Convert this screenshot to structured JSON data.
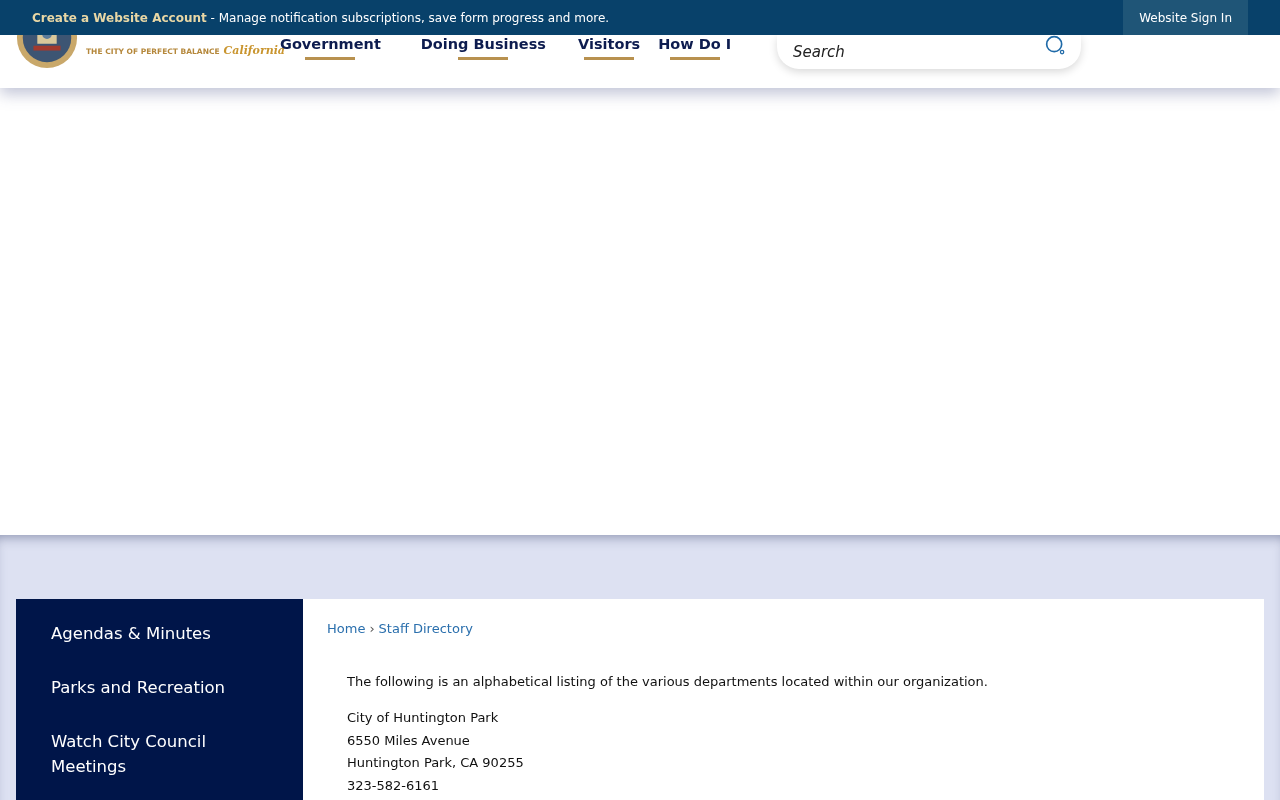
{
  "top_bar": {
    "account_link": "Create a Website Account",
    "message": " - Manage notification subscriptions, save form progress and more.",
    "sign_in": "Website Sign In"
  },
  "logo": {
    "tagline": "THE CITY OF PERFECT BALANCE",
    "state": "California"
  },
  "nav": [
    {
      "label": "Government"
    },
    {
      "label": "Doing Business"
    },
    {
      "label": "Visitors"
    },
    {
      "label": "How Do I"
    }
  ],
  "search": {
    "placeholder": "Search"
  },
  "sidebar": {
    "items": [
      {
        "label": "Agendas & Minutes"
      },
      {
        "label": "Parks and Recreation"
      },
      {
        "label": "Watch City Council Meetings"
      }
    ]
  },
  "breadcrumb_separator": "›",
  "breadcrumb": [
    {
      "label": "Home"
    },
    {
      "label": "Staff Directory"
    }
  ],
  "intro": "The following is an alphabetical listing of the various departments located within our organization.",
  "address": [
    "City of Huntington Park",
    "6550 Miles Avenue",
    "Huntington Park, CA 90255",
    "323-582-6161"
  ]
}
